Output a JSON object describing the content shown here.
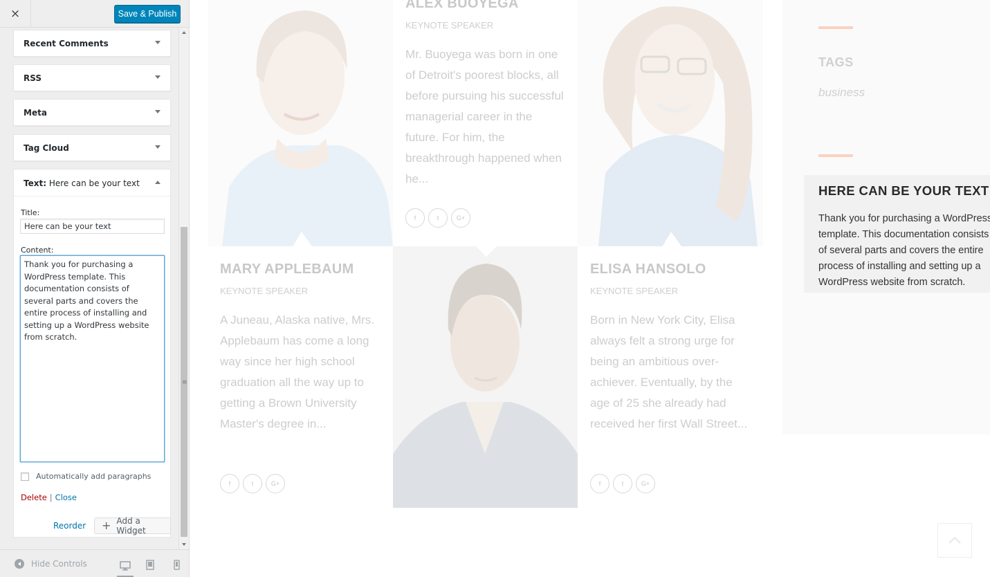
{
  "sidebar": {
    "close_icon": "×",
    "publish_label": "Save & Publish",
    "widgets": [
      {
        "label": "Recent Comments"
      },
      {
        "label": "RSS"
      },
      {
        "label": "Meta"
      },
      {
        "label": "Tag Cloud"
      }
    ],
    "text_widget": {
      "type_label": "Text:",
      "title_suffix": "Here can be your text",
      "title_label": "Title:",
      "title_value": "Here can be your text",
      "content_label": "Content:",
      "content_value": "Thank you for purchasing a WordPress template. This documentation consists of several parts and covers the entire process of installing and setting up a WordPress website from scratch.",
      "autop_label": "Automatically add paragraphs",
      "autop_checked": false,
      "delete_label": "Delete",
      "separator": "|",
      "close_label": "Close"
    },
    "reorder_label": "Reorder",
    "add_widget_label": "Add a Widget",
    "footer": {
      "hide_controls_label": "Hide Controls",
      "active_device": "desktop"
    }
  },
  "preview": {
    "speakers": [
      {
        "name": "ALEX BUOYEGA",
        "role": "KEYNOTE SPEAKER",
        "bio": "Mr. Buoyega was born in one of Detroit's poorest blocks, all before pursuing his successful managerial career in the future. For him, the breakthrough happened when he..."
      },
      {
        "name": "MARY APPLEBAUM",
        "role": "KEYNOTE SPEAKER",
        "bio": "A Juneau, Alaska native, Mrs. Applebaum has come a long way since her high school graduation all the way up to getting a Brown University Master's degree in..."
      },
      {
        "name": "ELISA HANSOLO",
        "role": "KEYNOTE SPEAKER",
        "bio": "Born in New York City, Elisa always felt a strong urge for being an ambitious over-achiever. Eventually, by the age of 25 she already had received her first Wall Street..."
      }
    ],
    "social_icons": [
      "f",
      "t",
      "G+"
    ],
    "tags_title": "TAGS",
    "tag": "business",
    "text_widget_title": "HERE CAN BE YOUR TEXT",
    "text_widget_body": "Thank you for purchasing a WordPress template. This documentation consists of several parts and covers the entire process of installing and setting up a WordPress website from scratch.",
    "accent_color": "#f9d3bf"
  }
}
